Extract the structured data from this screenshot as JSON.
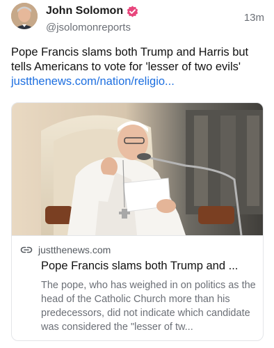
{
  "post": {
    "author_name": "John Solomon",
    "handle": "@jsolomonreports",
    "timestamp": "13m",
    "text": "Pope Francis slams both Trump and Harris but tells Americans to vote for 'lesser of two evils'",
    "link_text": "justthenews.com/nation/religio..."
  },
  "card": {
    "image_subject": "pope-speaking-photo",
    "domain": "justthenews.com",
    "title": "Pope Francis slams both Trump and ...",
    "description": "The pope, who has weighed in on politics as the head of the Catholic Church more than his predecessors, did not indicate which candidate was considered the \"lesser of tw..."
  },
  "colors": {
    "link": "#1d6fe0",
    "verified_badge": "#e8467c",
    "muted_text": "#6b6f76"
  }
}
